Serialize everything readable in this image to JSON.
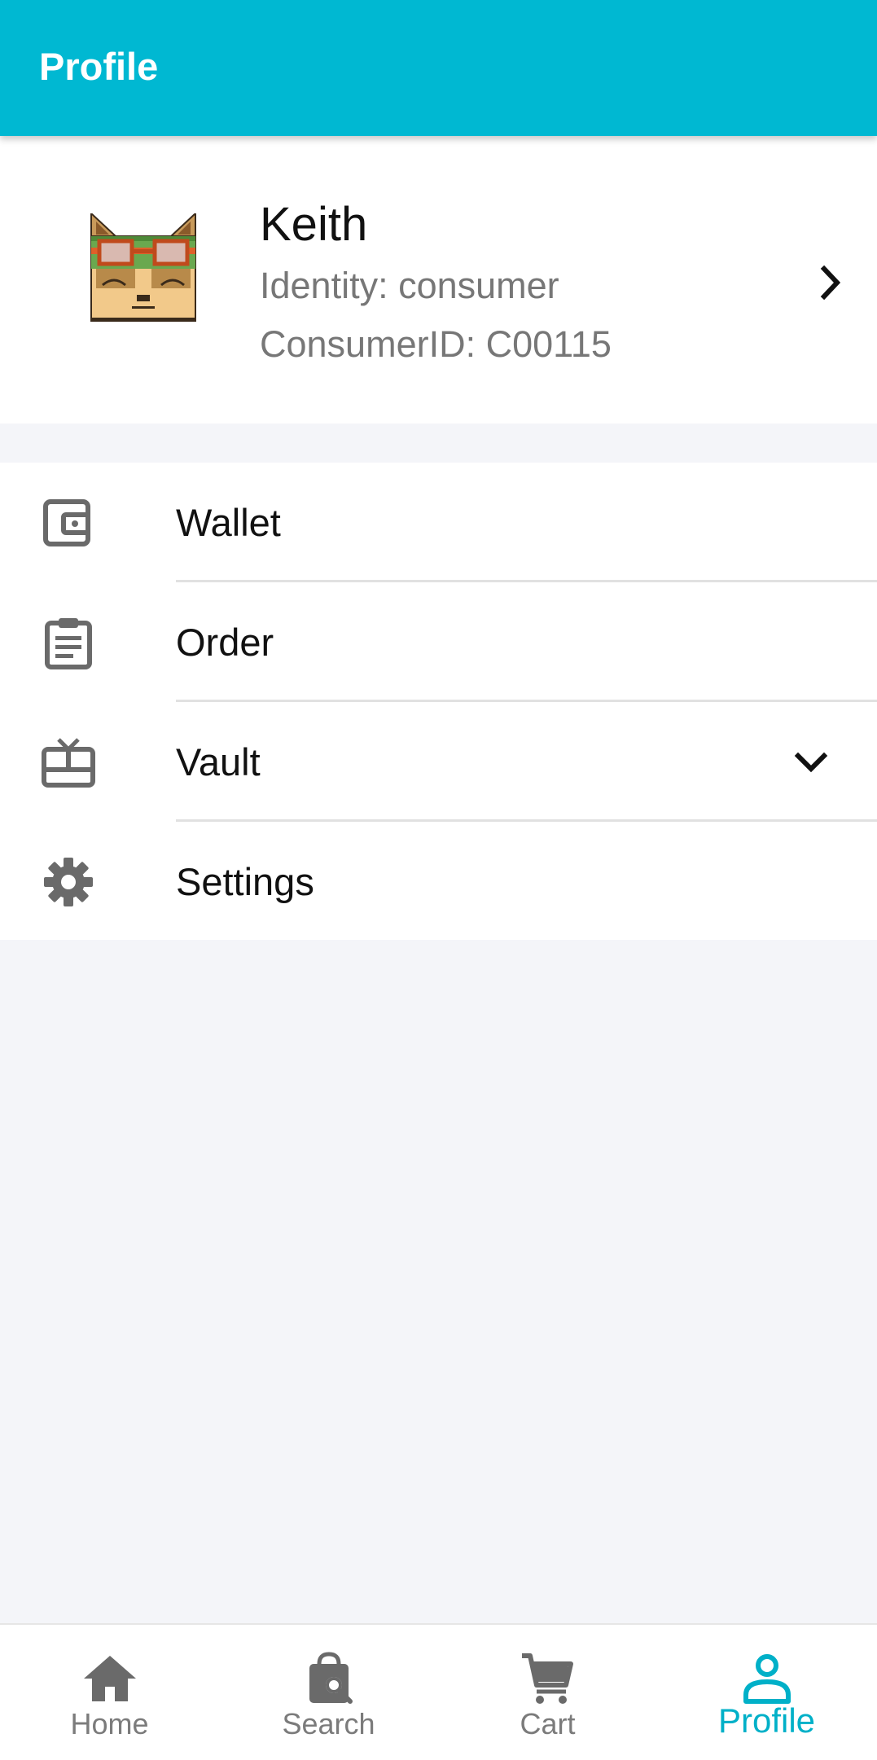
{
  "app_bar": {
    "title": "Profile"
  },
  "profile": {
    "name": "Keith",
    "identity": "Identity: consumer",
    "consumer_id": "ConsumerID: C00115"
  },
  "menu": {
    "items": [
      {
        "label": "Wallet",
        "icon": "wallet-icon"
      },
      {
        "label": "Order",
        "icon": "clipboard-icon"
      },
      {
        "label": "Vault",
        "icon": "gift-card-icon",
        "expandable": true
      },
      {
        "label": "Settings",
        "icon": "gear-icon"
      }
    ]
  },
  "bottom_nav": {
    "items": [
      {
        "label": "Home",
        "icon": "home-icon"
      },
      {
        "label": "Search",
        "icon": "search-bag-icon"
      },
      {
        "label": "Cart",
        "icon": "cart-icon"
      },
      {
        "label": "Profile",
        "icon": "person-icon",
        "active": true
      }
    ]
  },
  "colors": {
    "primary": "#00b8d2",
    "active_nav": "#00b0c8",
    "background": "#f4f5f9",
    "secondary_text": "#777777",
    "icon_gray": "#6a6a6a"
  }
}
